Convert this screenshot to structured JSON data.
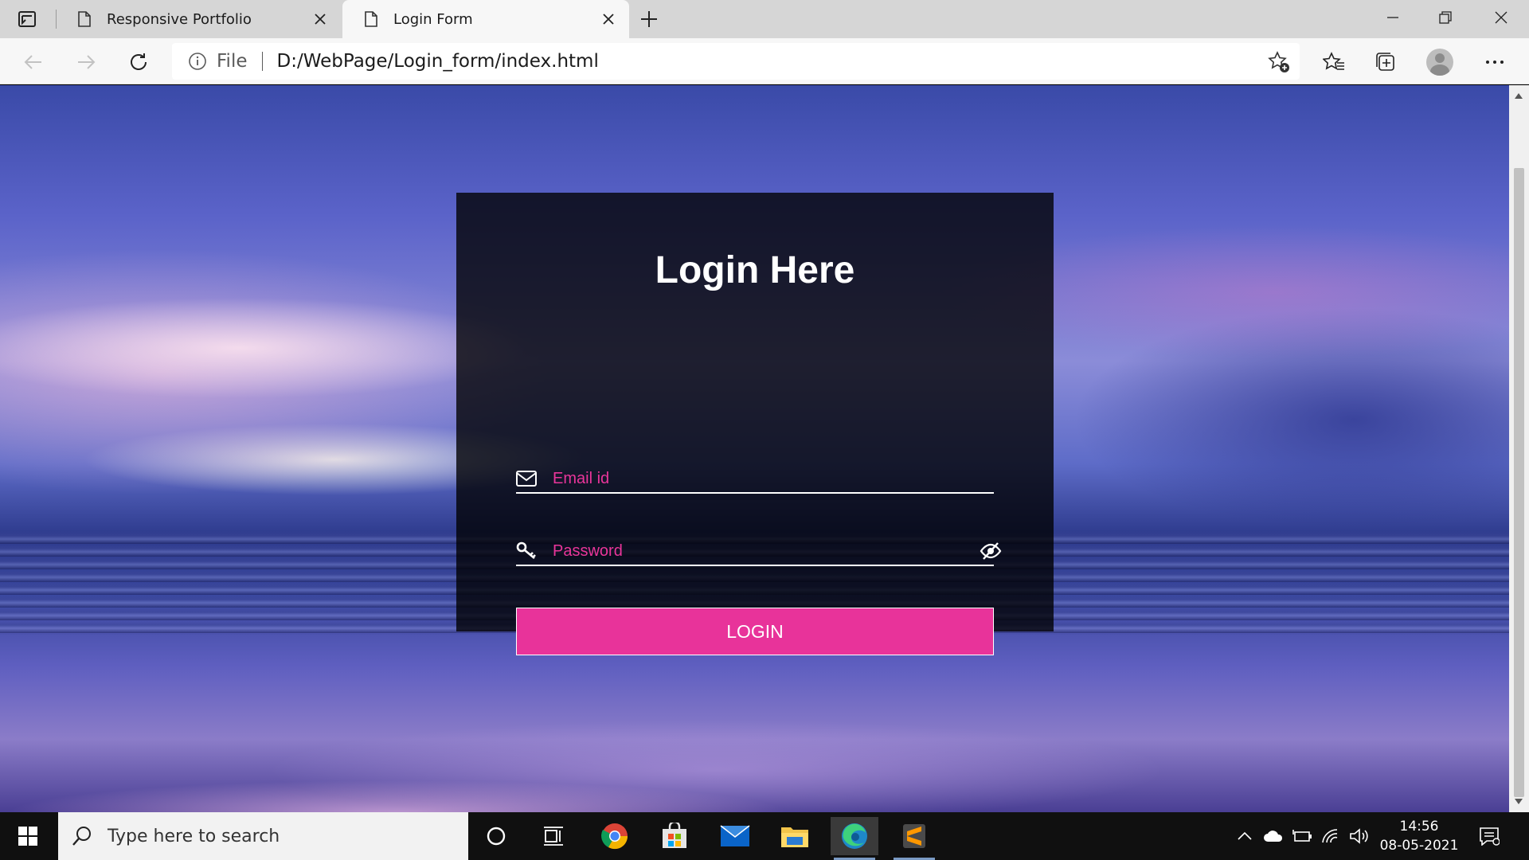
{
  "browser": {
    "tabs": [
      {
        "title": "Responsive Portfolio",
        "active": false
      },
      {
        "title": "Login Form",
        "active": true
      }
    ],
    "address": {
      "security_label": "File",
      "url": "D:/WebPage/Login_form/index.html"
    },
    "icons": {
      "tab_actions": "tab-actions-icon",
      "page": "page-icon",
      "close": "close-icon",
      "new_tab": "plus-icon",
      "minimize": "minimize-icon",
      "restore": "restore-icon",
      "window_close": "close-icon",
      "back": "arrow-left-icon",
      "forward": "arrow-right-icon",
      "refresh": "refresh-icon",
      "info": "info-icon",
      "add_favorite": "star-add-icon",
      "favorites": "favorites-icon",
      "collections": "collections-icon",
      "profile": "avatar",
      "more": "more-icon"
    }
  },
  "page": {
    "form": {
      "title": "Login Here",
      "email_placeholder": "Email id",
      "password_placeholder": "Password",
      "login_label": "LOGIN"
    },
    "colors": {
      "accent": "#e8339a",
      "card_bg": "rgba(0,0,0,0.78)",
      "title": "#ffffff"
    }
  },
  "taskbar": {
    "search_placeholder": "Type here to search",
    "apps": [
      "cortana-icon",
      "task-view-icon",
      "chrome-icon",
      "store-icon",
      "mail-icon",
      "file-explorer-icon",
      "edge-icon",
      "sublime-text-icon"
    ],
    "tray": [
      "chevron-up-icon",
      "onedrive-icon",
      "battery-icon",
      "wifi-icon",
      "volume-icon"
    ],
    "time": "14:56",
    "date": "08-05-2021"
  }
}
